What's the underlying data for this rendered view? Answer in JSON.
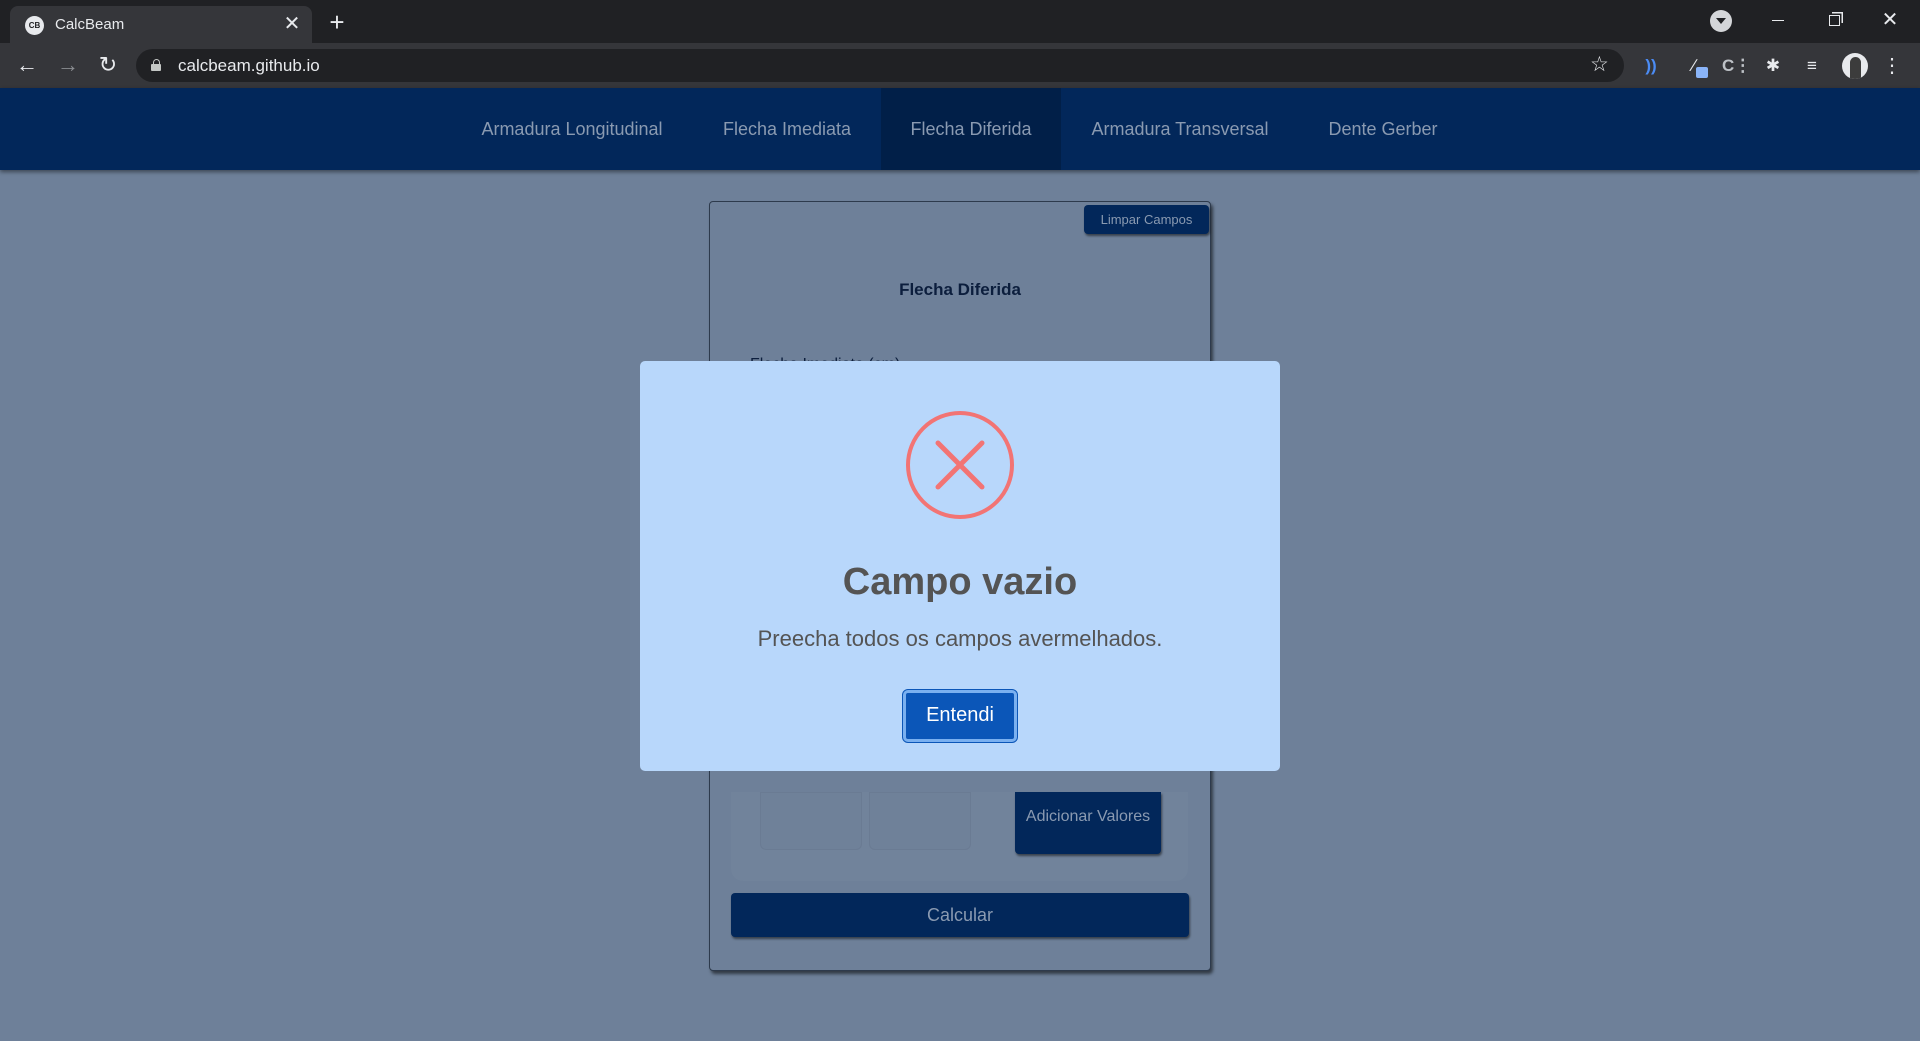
{
  "browser": {
    "tab_title": "CalcBeam",
    "tab_favicon_text": "CB",
    "tab_close": "✕",
    "new_tab": "+",
    "url": "calcbeam.github.io",
    "win_close": "✕"
  },
  "site_nav": {
    "items": [
      {
        "label": "Armadura Longitudinal",
        "active": false
      },
      {
        "label": "Flecha Imediata",
        "active": false
      },
      {
        "label": "Flecha Diferida",
        "active": true
      },
      {
        "label": "Armadura Transversal",
        "active": false
      },
      {
        "label": "Dente Gerber",
        "active": false
      }
    ]
  },
  "card": {
    "clear_button": "Limpar Campos",
    "title": "Flecha Diferida",
    "field_label": "Flecha Imediata (cm)",
    "add_values_button": "Adicionar Valores",
    "calculate_button": "Calcular"
  },
  "modal": {
    "icon": "error-x-icon",
    "title": "Campo vazio",
    "text": "Preecha todos os campos avermelhados.",
    "confirm_button": "Entendi",
    "icon_color": "#f27474",
    "button_color": "#0b56b8"
  },
  "colors": {
    "nav_bg": "#02275a",
    "page_bg": "#6e8099",
    "modal_bg": "#b8d7fb"
  }
}
